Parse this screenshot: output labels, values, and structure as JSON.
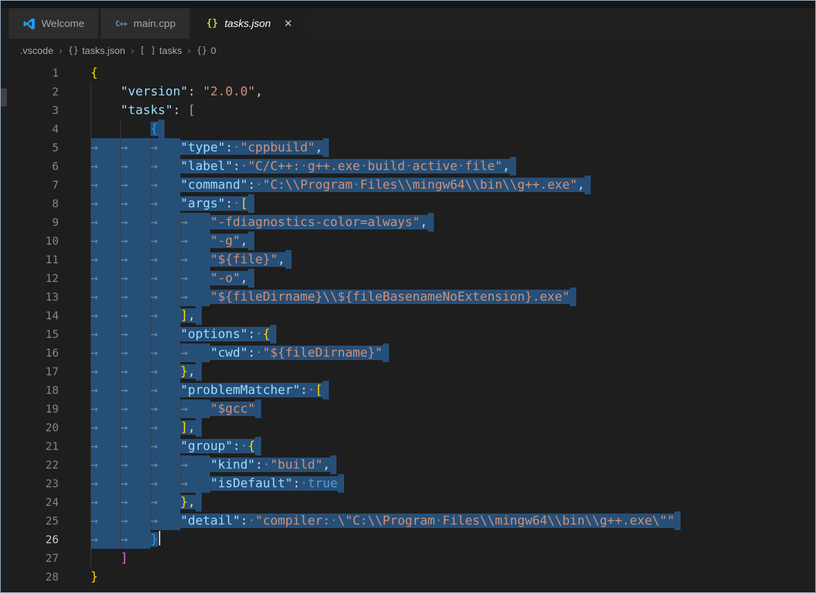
{
  "tabs": [
    {
      "id": "welcome",
      "label": "Welcome",
      "icon": "vscode-logo",
      "active": false,
      "italic": false
    },
    {
      "id": "main-cpp",
      "label": "main.cpp",
      "icon": "cpp-file",
      "active": false,
      "italic": false
    },
    {
      "id": "tasks-json",
      "label": "tasks.json",
      "icon": "json-file",
      "active": true,
      "italic": true,
      "close_label": "✕"
    }
  ],
  "breadcrumb": {
    "separator": "›",
    "items": [
      {
        "label": ".vscode"
      },
      {
        "icon": "{}",
        "label": "tasks.json"
      },
      {
        "icon": "[ ]",
        "label": "tasks"
      },
      {
        "icon": "{}",
        "label": "0"
      }
    ]
  },
  "editor": {
    "cursor_line": 26,
    "selection": {
      "from_line": 4,
      "to_line": 26
    },
    "lines": [
      {
        "n": 1,
        "i": 0,
        "sel": "none",
        "toks": [
          [
            "b1",
            "{"
          ]
        ]
      },
      {
        "n": 2,
        "i": 1,
        "sel": "none",
        "toks": [
          [
            "k",
            "\"version\""
          ],
          [
            "p",
            ":"
          ],
          [
            "p",
            " "
          ],
          [
            "s",
            "\"2.0.0\""
          ],
          [
            "p",
            ","
          ]
        ]
      },
      {
        "n": 3,
        "i": 1,
        "sel": "none",
        "toks": [
          [
            "k",
            "\"tasks\""
          ],
          [
            "p",
            ":"
          ],
          [
            "p",
            " "
          ],
          [
            "b2",
            "["
          ]
        ]
      },
      {
        "n": 4,
        "i": 2,
        "sel": "last",
        "nl": true,
        "toks": [
          [
            "b3",
            "{"
          ]
        ]
      },
      {
        "n": 5,
        "i": 3,
        "sel": "full",
        "nl": true,
        "toks": [
          [
            "k",
            "\"type\""
          ],
          [
            "p",
            ":"
          ],
          [
            "p",
            " "
          ],
          [
            "s",
            "\"cppbuild\""
          ],
          [
            "p",
            ","
          ]
        ]
      },
      {
        "n": 6,
        "i": 3,
        "sel": "full",
        "nl": true,
        "toks": [
          [
            "k",
            "\"label\""
          ],
          [
            "p",
            ":"
          ],
          [
            "p",
            " "
          ],
          [
            "s",
            "\"C/C++: g++.exe build active file\""
          ],
          [
            "p",
            ","
          ]
        ]
      },
      {
        "n": 7,
        "i": 3,
        "sel": "full",
        "nl": true,
        "toks": [
          [
            "k",
            "\"command\""
          ],
          [
            "p",
            ":"
          ],
          [
            "p",
            " "
          ],
          [
            "s",
            "\"C:\\\\Program Files\\\\mingw64\\\\bin\\\\g++.exe\""
          ],
          [
            "p",
            ","
          ]
        ]
      },
      {
        "n": 8,
        "i": 3,
        "sel": "full",
        "nl": true,
        "toks": [
          [
            "k",
            "\"args\""
          ],
          [
            "p",
            ":"
          ],
          [
            "p",
            " "
          ],
          [
            "b1",
            "["
          ]
        ]
      },
      {
        "n": 9,
        "i": 4,
        "sel": "full",
        "nl": true,
        "toks": [
          [
            "s",
            "\"-fdiagnostics-color=always\""
          ],
          [
            "p",
            ","
          ]
        ]
      },
      {
        "n": 10,
        "i": 4,
        "sel": "full",
        "nl": true,
        "toks": [
          [
            "s",
            "\"-g\""
          ],
          [
            "p",
            ","
          ]
        ]
      },
      {
        "n": 11,
        "i": 4,
        "sel": "full",
        "nl": true,
        "toks": [
          [
            "s",
            "\"${file}\""
          ],
          [
            "p",
            ","
          ]
        ]
      },
      {
        "n": 12,
        "i": 4,
        "sel": "full",
        "nl": true,
        "toks": [
          [
            "s",
            "\"-o\""
          ],
          [
            "p",
            ","
          ]
        ]
      },
      {
        "n": 13,
        "i": 4,
        "sel": "full",
        "nl": true,
        "toks": [
          [
            "s",
            "\"${fileDirname}\\\\${fileBasenameNoExtension}.exe\""
          ]
        ]
      },
      {
        "n": 14,
        "i": 3,
        "sel": "full",
        "nl": true,
        "toks": [
          [
            "b1",
            "]"
          ],
          [
            "p",
            ","
          ]
        ]
      },
      {
        "n": 15,
        "i": 3,
        "sel": "full",
        "nl": true,
        "toks": [
          [
            "k",
            "\"options\""
          ],
          [
            "p",
            ":"
          ],
          [
            "p",
            " "
          ],
          [
            "b1",
            "{"
          ]
        ]
      },
      {
        "n": 16,
        "i": 4,
        "sel": "full",
        "nl": true,
        "toks": [
          [
            "k",
            "\"cwd\""
          ],
          [
            "p",
            ":"
          ],
          [
            "p",
            " "
          ],
          [
            "s",
            "\"${fileDirname}\""
          ]
        ]
      },
      {
        "n": 17,
        "i": 3,
        "sel": "full",
        "nl": true,
        "toks": [
          [
            "b1",
            "}"
          ],
          [
            "p",
            ","
          ]
        ]
      },
      {
        "n": 18,
        "i": 3,
        "sel": "full",
        "nl": true,
        "toks": [
          [
            "k",
            "\"problemMatcher\""
          ],
          [
            "p",
            ":"
          ],
          [
            "p",
            " "
          ],
          [
            "b1",
            "["
          ]
        ]
      },
      {
        "n": 19,
        "i": 4,
        "sel": "full",
        "nl": true,
        "toks": [
          [
            "s",
            "\"$gcc\""
          ]
        ]
      },
      {
        "n": 20,
        "i": 3,
        "sel": "full",
        "nl": true,
        "toks": [
          [
            "b1",
            "]"
          ],
          [
            "p",
            ","
          ]
        ]
      },
      {
        "n": 21,
        "i": 3,
        "sel": "full",
        "nl": true,
        "toks": [
          [
            "k",
            "\"group\""
          ],
          [
            "p",
            ":"
          ],
          [
            "p",
            " "
          ],
          [
            "b1",
            "{"
          ]
        ]
      },
      {
        "n": 22,
        "i": 4,
        "sel": "full",
        "nl": true,
        "toks": [
          [
            "k",
            "\"kind\""
          ],
          [
            "p",
            ":"
          ],
          [
            "p",
            " "
          ],
          [
            "s",
            "\"build\""
          ],
          [
            "p",
            ","
          ]
        ]
      },
      {
        "n": 23,
        "i": 4,
        "sel": "full",
        "nl": true,
        "toks": [
          [
            "k",
            "\"isDefault\""
          ],
          [
            "p",
            ":"
          ],
          [
            "p",
            " "
          ],
          [
            "kw",
            "true"
          ]
        ]
      },
      {
        "n": 24,
        "i": 3,
        "sel": "full",
        "nl": true,
        "toks": [
          [
            "b1",
            "}"
          ],
          [
            "p",
            ","
          ]
        ]
      },
      {
        "n": 25,
        "i": 3,
        "sel": "full",
        "nl": true,
        "toks": [
          [
            "k",
            "\"detail\""
          ],
          [
            "p",
            ":"
          ],
          [
            "p",
            " "
          ],
          [
            "s",
            "\"compiler: \\\"C:\\\\Program Files\\\\mingw64\\\\bin\\\\g++.exe\\\"\""
          ]
        ]
      },
      {
        "n": 26,
        "i": 2,
        "sel": "full",
        "nl": false,
        "cur": true,
        "toks": [
          [
            "b3",
            "}"
          ]
        ]
      },
      {
        "n": 27,
        "i": 1,
        "sel": "none",
        "toks": [
          [
            "b2",
            "]"
          ]
        ]
      },
      {
        "n": 28,
        "i": 0,
        "sel": "none",
        "toks": [
          [
            "b1",
            "}"
          ]
        ]
      }
    ]
  },
  "colors": {
    "editor_bg": "#1e1e1e",
    "selection": "#264f78",
    "key": "#9cdcfe",
    "string": "#ce9178",
    "punctuation": "#d4d4d4",
    "bracket_l1": "#ffd700",
    "bracket_l2": "#da70d6",
    "bracket_l3": "#179fff",
    "keyword": "#569cd6",
    "line_number": "#858585",
    "line_number_active": "#c6c6c6"
  }
}
